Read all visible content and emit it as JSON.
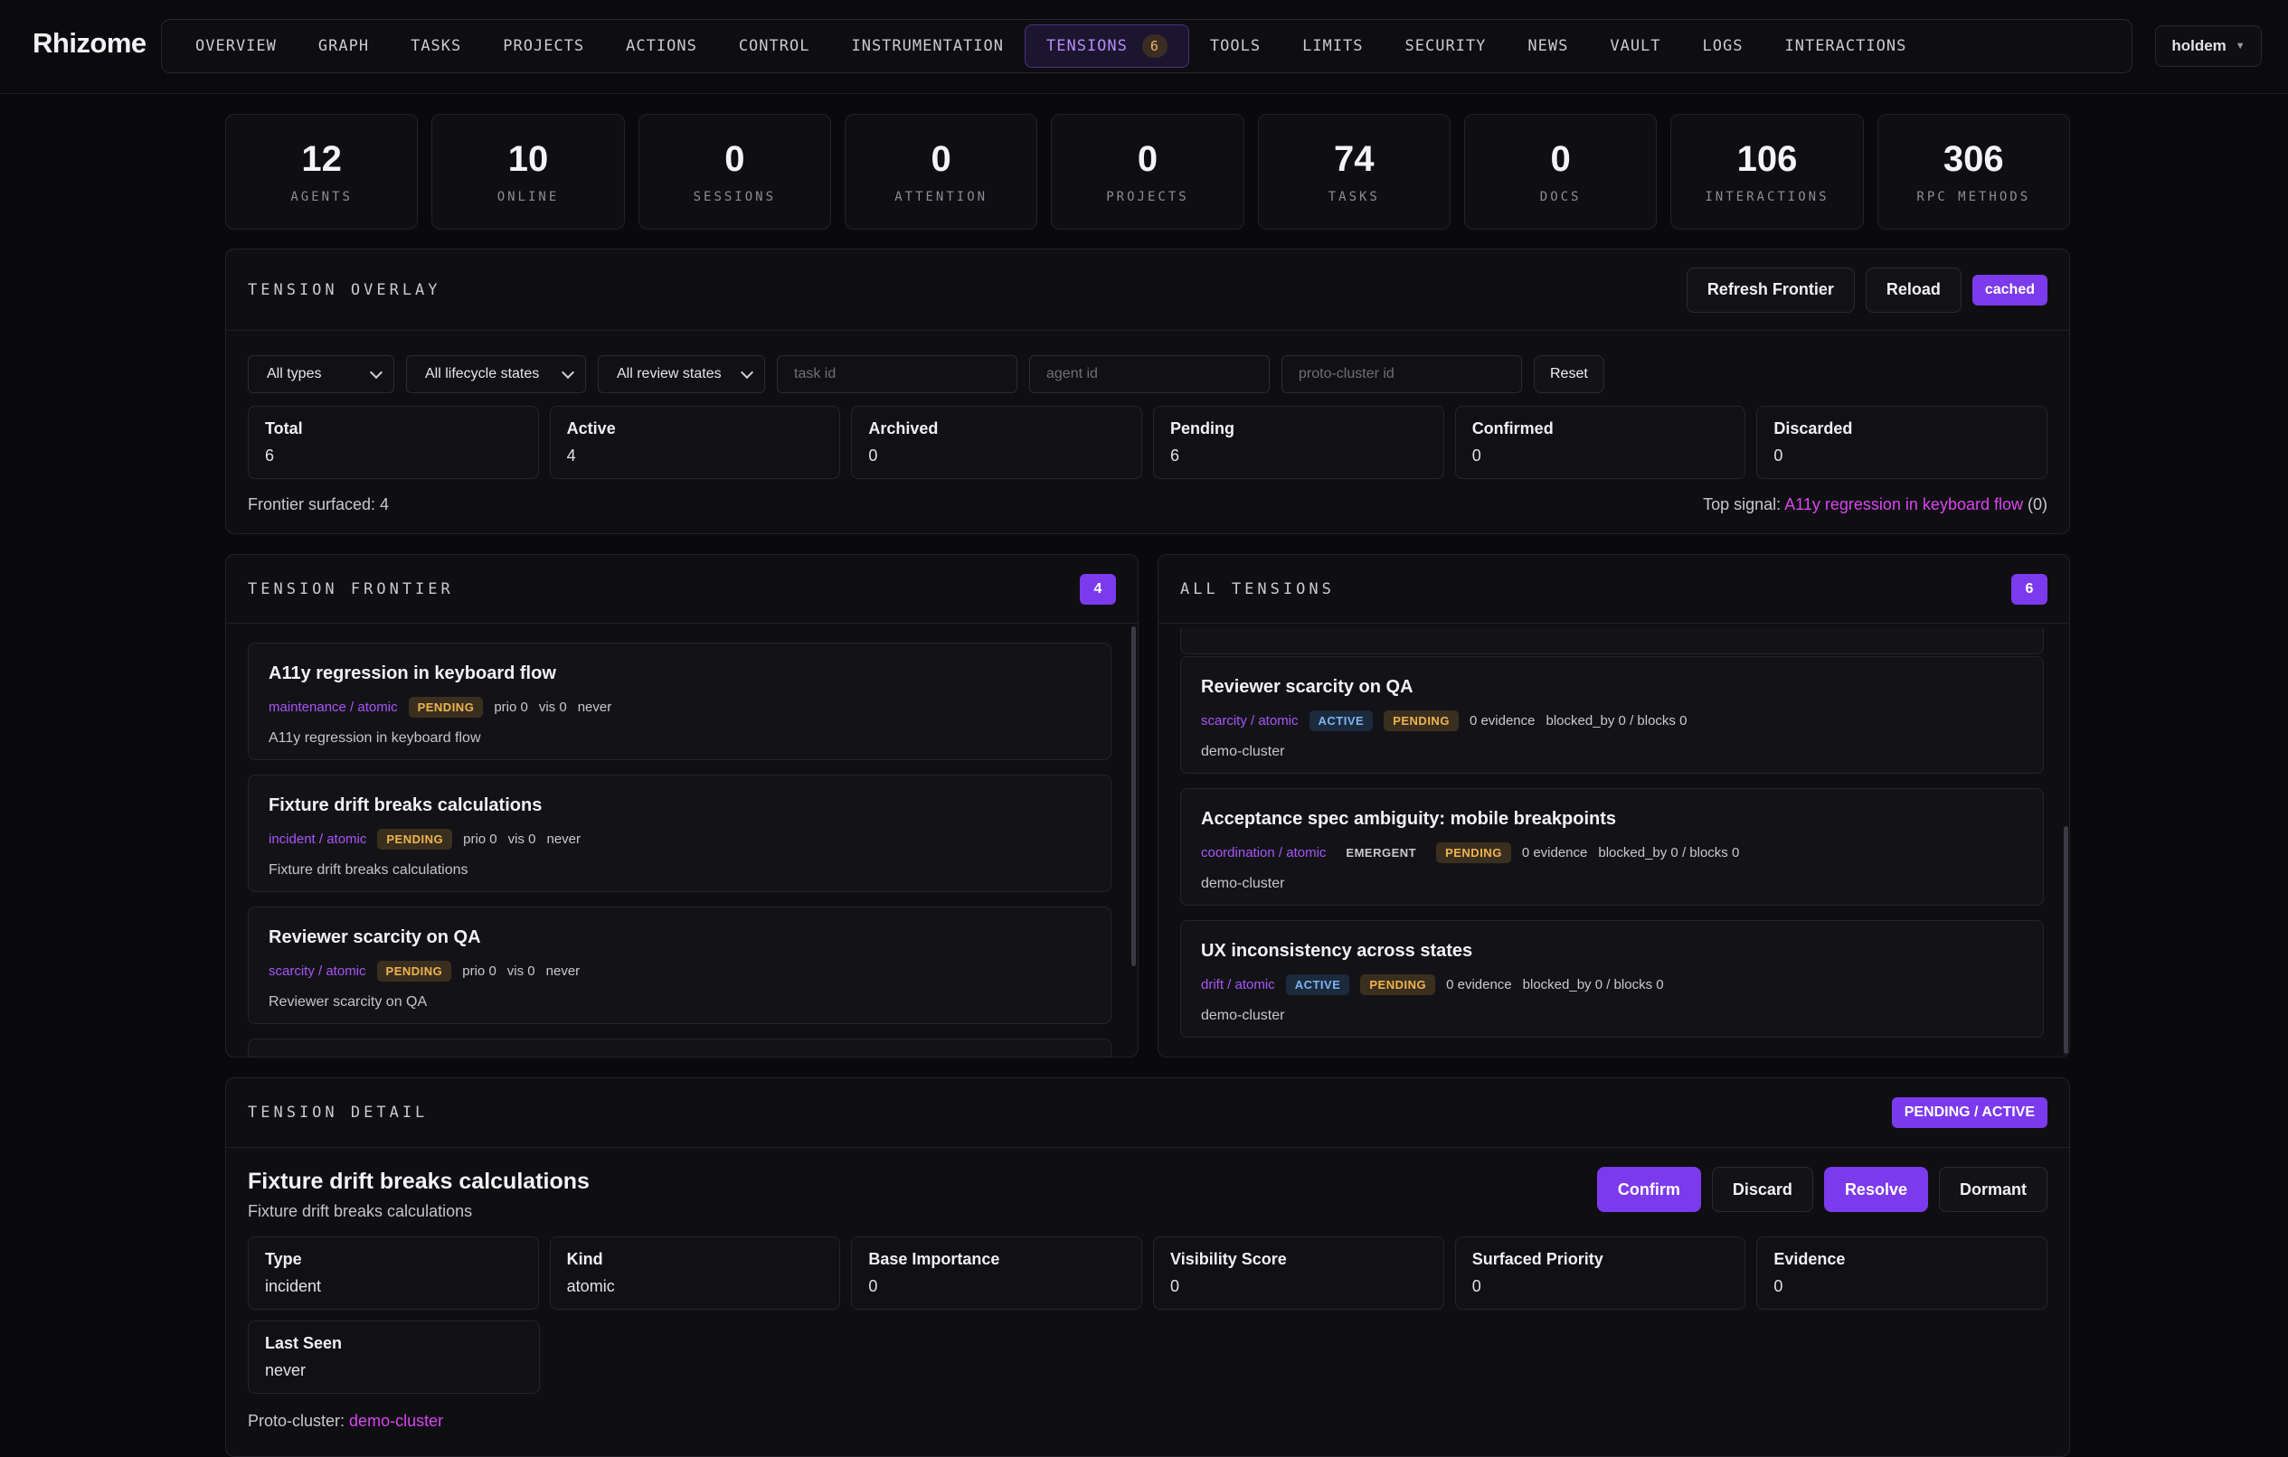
{
  "app": {
    "brand": "Rhizome",
    "user": "holdem"
  },
  "nav": {
    "items": [
      "OVERVIEW",
      "GRAPH",
      "TASKS",
      "PROJECTS",
      "ACTIONS",
      "CONTROL",
      "INSTRUMENTATION",
      "TENSIONS",
      "TOOLS",
      "LIMITS",
      "SECURITY",
      "NEWS",
      "VAULT",
      "LOGS",
      "INTERACTIONS"
    ],
    "active": "TENSIONS",
    "active_badge": "6"
  },
  "stats": [
    {
      "value": "12",
      "label": "AGENTS"
    },
    {
      "value": "10",
      "label": "ONLINE"
    },
    {
      "value": "0",
      "label": "SESSIONS"
    },
    {
      "value": "0",
      "label": "ATTENTION"
    },
    {
      "value": "0",
      "label": "PROJECTS"
    },
    {
      "value": "74",
      "label": "TASKS"
    },
    {
      "value": "0",
      "label": "DOCS"
    },
    {
      "value": "106",
      "label": "INTERACTIONS"
    },
    {
      "value": "306",
      "label": "RPC METHODS"
    }
  ],
  "overlay": {
    "title": "TENSION OVERLAY",
    "refresh_label": "Refresh Frontier",
    "reload_label": "Reload",
    "cached_label": "cached",
    "filters": {
      "type": "All types",
      "lifecycle": "All lifecycle states",
      "review": "All review states",
      "task_placeholder": "task id",
      "agent_placeholder": "agent id",
      "cluster_placeholder": "proto-cluster id",
      "reset_label": "Reset"
    },
    "metrics": [
      {
        "label": "Total",
        "value": "6"
      },
      {
        "label": "Active",
        "value": "4"
      },
      {
        "label": "Archived",
        "value": "0"
      },
      {
        "label": "Pending",
        "value": "6"
      },
      {
        "label": "Confirmed",
        "value": "0"
      },
      {
        "label": "Discarded",
        "value": "0"
      }
    ],
    "frontier_surfaced": "Frontier surfaced: 4",
    "top_signal_prefix": "Top signal: ",
    "top_signal_link": "A11y regression in keyboard flow",
    "top_signal_suffix": " (0)"
  },
  "frontier": {
    "title": "TENSION FRONTIER",
    "count": "4",
    "cards": [
      {
        "title": "A11y regression in keyboard flow",
        "type": "maintenance / atomic",
        "review": "PENDING",
        "prio": "prio 0",
        "vis": "vis 0",
        "seen": "never",
        "desc": "A11y regression in keyboard flow"
      },
      {
        "title": "Fixture drift breaks calculations",
        "type": "incident / atomic",
        "review": "PENDING",
        "prio": "prio 0",
        "vis": "vis 0",
        "seen": "never",
        "desc": "Fixture drift breaks calculations"
      },
      {
        "title": "Reviewer scarcity on QA",
        "type": "scarcity / atomic",
        "review": "PENDING",
        "prio": "prio 0",
        "vis": "vis 0",
        "seen": "never",
        "desc": "Reviewer scarcity on QA"
      }
    ]
  },
  "all_tensions": {
    "title": "ALL TENSIONS",
    "count": "6",
    "cards": [
      {
        "title": "Reviewer scarcity on QA",
        "type": "scarcity / atomic",
        "lifecycle": "ACTIVE",
        "review": "PENDING",
        "evidence": "0 evidence",
        "blocks": "blocked_by 0 / blocks 0",
        "cluster": "demo-cluster"
      },
      {
        "title": "Acceptance spec ambiguity: mobile breakpoints",
        "type": "coordination / atomic",
        "lifecycle": "EMERGENT",
        "review": "PENDING",
        "evidence": "0 evidence",
        "blocks": "blocked_by 0 / blocks 0",
        "cluster": "demo-cluster"
      },
      {
        "title": "UX inconsistency across states",
        "type": "drift / atomic",
        "lifecycle": "ACTIVE",
        "review": "PENDING",
        "evidence": "0 evidence",
        "blocks": "blocked_by 0 / blocks 0",
        "cluster": "demo-cluster"
      }
    ]
  },
  "detail": {
    "title": "TENSION DETAIL",
    "status_pill": "PENDING / ACTIVE",
    "name": "Fixture drift breaks calculations",
    "description": "Fixture drift breaks calculations",
    "confirm_label": "Confirm",
    "discard_label": "Discard",
    "resolve_label": "Resolve",
    "dormant_label": "Dormant",
    "fields": [
      {
        "label": "Type",
        "value": "incident"
      },
      {
        "label": "Kind",
        "value": "atomic"
      },
      {
        "label": "Base Importance",
        "value": "0"
      },
      {
        "label": "Visibility Score",
        "value": "0"
      },
      {
        "label": "Surfaced Priority",
        "value": "0"
      },
      {
        "label": "Evidence",
        "value": "0"
      }
    ],
    "last_seen": {
      "label": "Last Seen",
      "value": "never"
    },
    "proto_cluster_prefix": "Proto-cluster: ",
    "proto_cluster_link": "demo-cluster"
  }
}
